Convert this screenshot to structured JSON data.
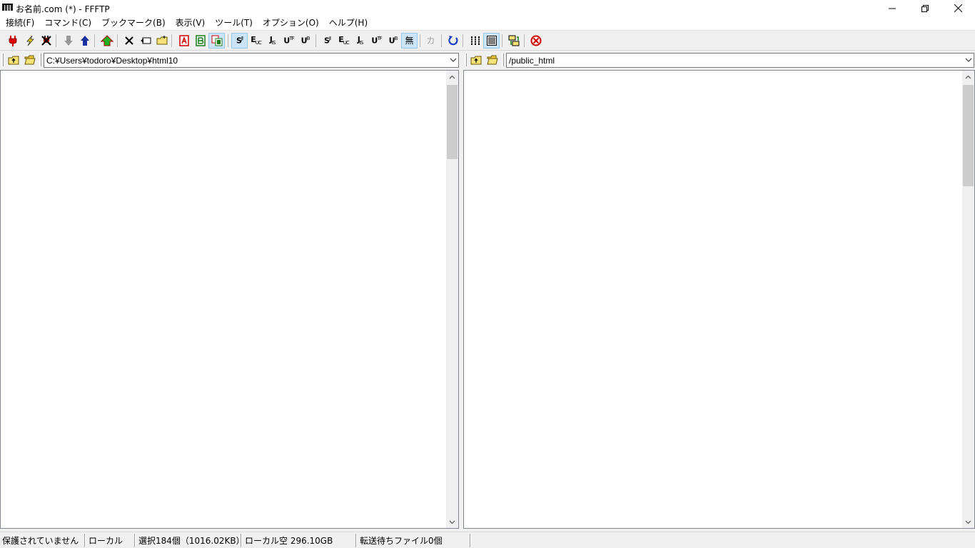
{
  "window": {
    "title": "お名前.com (*) - FFFTP",
    "controls": [
      "minimize",
      "restore",
      "close"
    ]
  },
  "menu": {
    "items": [
      "接続(F)",
      "コマンド(C)",
      "ブックマーク(B)",
      "表示(V)",
      "ツール(T)",
      "オプション(O)",
      "ヘルプ(H)"
    ]
  },
  "toolbar": {
    "icons": [
      "connect-icon",
      "quick-connect-icon",
      "disconnect-icon",
      "download-icon",
      "upload-icon",
      "mirror-upload-icon",
      "delete-icon",
      "rename-icon",
      "mkdir-icon",
      "ascii-mode-icon",
      "binary-mode-icon",
      "auto-mode-icon",
      "kanji-sjis-icon",
      "kanji-euc-icon",
      "kanji-jis-icon",
      "kanji-utf8n-icon",
      "kanji-utf8bom-icon",
      "kanji-sjis-icon",
      "kanji-euc-icon",
      "kanji-jis-icon",
      "kanji-utf8n-icon",
      "kanji-utf8bom-icon",
      "kanji-none-icon",
      "kana-convert-icon",
      "refresh-icon",
      "list-view-icon",
      "detail-view-icon",
      "sync-folders-icon",
      "stop-icon"
    ],
    "kanji_labels": {
      "sjis": "S",
      "sjis_sup": "JI",
      "euc": "E",
      "euc_sub": "UC",
      "jis": "J",
      "jis_sub": "IS",
      "utf8n": "U",
      "utf8n_sup": "TF",
      "utf8bom": "U",
      "utf8bom_sup": "B",
      "none": "無",
      "kana": "カ"
    },
    "colors": {
      "pressed_bg": "#cce4f7",
      "accent_red": "#d00000",
      "accent_blue": "#1a3fbf",
      "accent_green": "#22a022"
    }
  },
  "local": {
    "path": "C:¥Users¥todoro¥Desktop¥html10",
    "up_icon": "folder-up-icon",
    "open_icon": "folder-open-icon"
  },
  "remote": {
    "path": "/public_html",
    "up_icon": "folder-up-icon",
    "open_icon": "folder-open-icon"
  },
  "status": {
    "security": "保護されていません",
    "focus": "ローカル",
    "selection": "選択184個（1016.02KB）",
    "local_free": "ローカル空 296.10GB",
    "queue": "転送待ちファイル0個"
  }
}
